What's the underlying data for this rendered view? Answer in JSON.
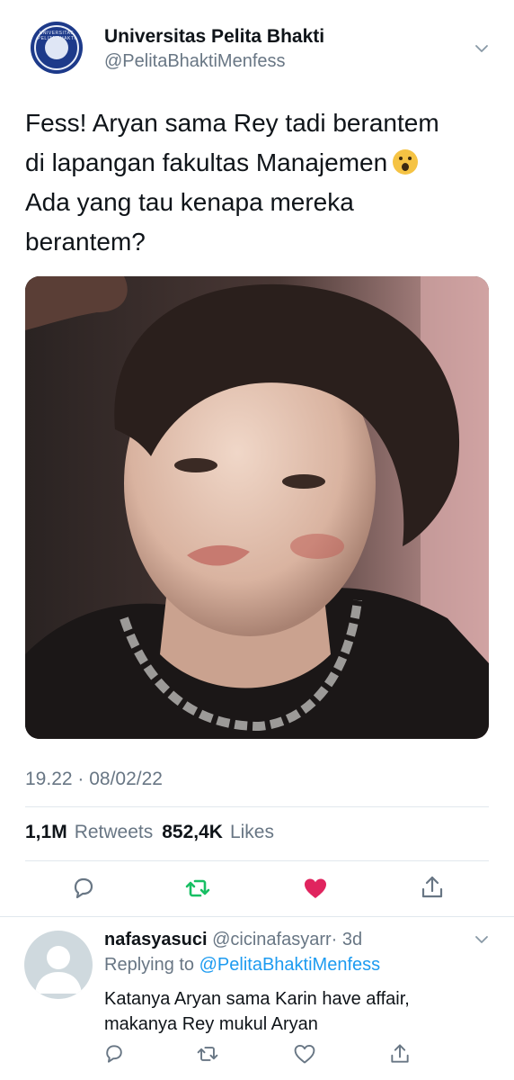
{
  "tweet": {
    "author": {
      "display_name": "Universitas Pelita Bhakti",
      "handle": "@PelitaBhaktiMenfess",
      "avatar_icon": "university-seal-icon",
      "seal_text": "UNIVERSITAS PELITA BHAKTI"
    },
    "text_lines": [
      "Fess! Aryan sama Rey tadi berantem",
      "di lapangan fakultas Manajemen",
      "Ada yang tau kenapa mereka",
      "berantem?"
    ],
    "emoji_icon": "screaming-face-emoji",
    "timestamp": "19.22 · 08/02/22",
    "retweet_count": "1,1M",
    "retweet_label": "Retweets",
    "like_count": "852,4K",
    "like_label": "Likes"
  },
  "reply": {
    "username": "nafasyasuci",
    "handle": "@cicinafasyarr",
    "age": "· 3d",
    "replying_label": "Replying to",
    "replying_handle": "@PelitaBhaktiMenfess",
    "text_lines": [
      "Katanya Aryan sama Karin have affair,",
      "makanya Rey mukul Aryan"
    ]
  },
  "colors": {
    "accent": "#1d9bf0",
    "retweeted": "#17bf63",
    "liked": "#e0245e",
    "muted": "#687684",
    "divider": "#e1e8ed"
  }
}
